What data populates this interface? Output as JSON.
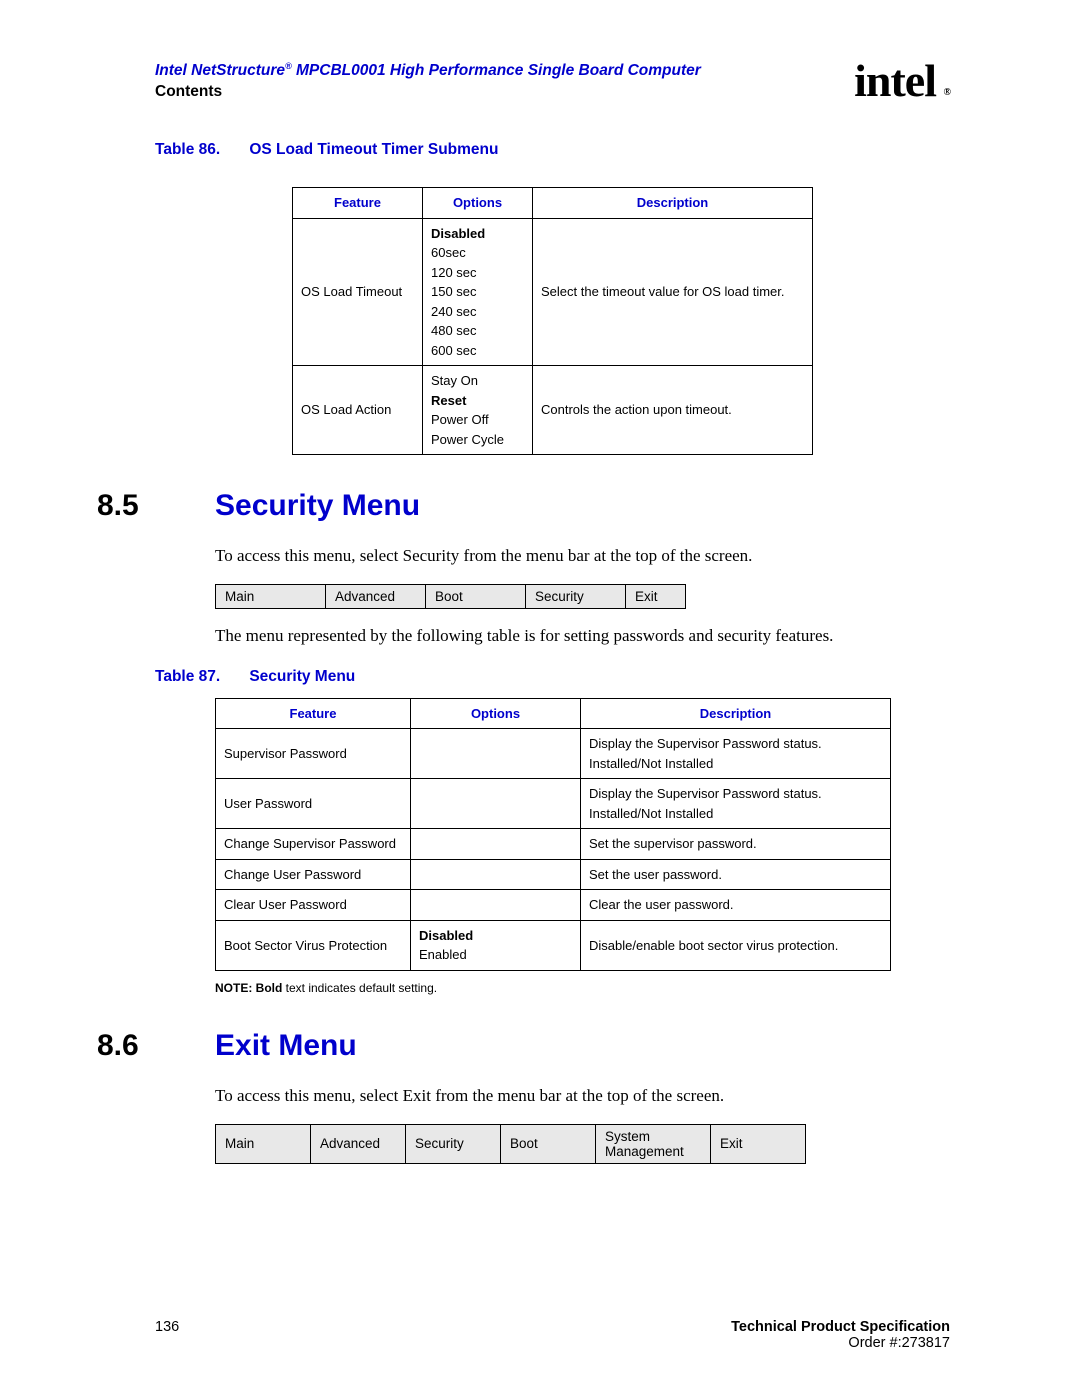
{
  "header": {
    "title_pre": "Intel NetStructure",
    "title_post": " MPCBL0001 High Performance Single Board Computer",
    "subtitle": "Contents",
    "logo_text": "intel",
    "reg": "®"
  },
  "table86": {
    "caption_num": "Table 86.",
    "caption_title": "OS Load Timeout Timer Submenu",
    "headers": [
      "Feature",
      "Options",
      "Description"
    ],
    "row1_feature": "OS Load Timeout",
    "row1_options": [
      "Disabled",
      "60sec",
      "120 sec",
      "150 sec",
      "240 sec",
      "480 sec",
      "600 sec"
    ],
    "row1_desc": "Select the timeout value for OS load timer.",
    "row2_feature": "OS Load Action",
    "row2_options": [
      "Stay On",
      "Reset",
      "Power Off",
      "Power Cycle"
    ],
    "row2_desc": "Controls the action upon timeout."
  },
  "section85": {
    "num": "8.5",
    "title": "Security Menu",
    "para1": "To access this menu, select Security from the menu bar at the top of the screen.",
    "menubar": [
      "Main",
      "Advanced",
      "Boot",
      "Security",
      "Exit"
    ],
    "para2": "The menu represented by the following table is for setting passwords and security features."
  },
  "table87": {
    "caption_num": "Table 87.",
    "caption_title": "Security Menu",
    "headers": [
      "Feature",
      "Options",
      "Description"
    ],
    "rows": [
      {
        "f": "Supervisor Password",
        "o": "",
        "d": "Display the Supervisor Password status. Installed/Not Installed"
      },
      {
        "f": "User Password",
        "o": "",
        "d": "Display the Supervisor Password status. Installed/Not Installed"
      },
      {
        "f": "Change Supervisor Password",
        "o": "",
        "d": "Set the supervisor password."
      },
      {
        "f": "Change User Password",
        "o": "",
        "d": "Set the user password."
      },
      {
        "f": "Clear User Password",
        "o": "",
        "d": "Clear the user password."
      }
    ],
    "row6_feature": "Boot Sector Virus Protection",
    "row6_opt_bold": "Disabled",
    "row6_opt2": "Enabled",
    "row6_desc": "Disable/enable boot sector virus protection.",
    "note_label": "NOTE:  Bold",
    "note_rest": " text indicates default setting."
  },
  "section86": {
    "num": "8.6",
    "title": "Exit Menu",
    "para1": "To access this menu, select Exit from the menu bar at the top of the screen.",
    "menubar": [
      "Main",
      "Advanced",
      "Security",
      "Boot",
      "System Management",
      "Exit"
    ]
  },
  "footer": {
    "page": "136",
    "tps": "Technical Product Specification",
    "order": "Order #:273817"
  }
}
